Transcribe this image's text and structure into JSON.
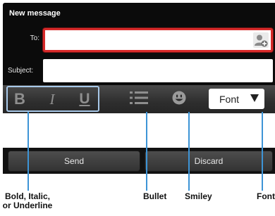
{
  "window": {
    "title": "New message"
  },
  "compose": {
    "to_label": "To:",
    "to_value": "",
    "subject_label": "Subject:",
    "subject_value": "",
    "body_value": ""
  },
  "toolbar": {
    "bold_glyph": "B",
    "italic_glyph": "I",
    "underline_glyph": "U",
    "font_label": "Font"
  },
  "actions": {
    "send_label": "Send",
    "discard_label": "Discard"
  },
  "callouts": {
    "bold_line1": "Bold, Italic,",
    "bold_line2": "or Underline",
    "bullet": "Bullet",
    "smiley": "Smiley",
    "font": "Font"
  },
  "colors": {
    "focus_border": "#d72a2a",
    "group_highlight": "#a8c8e8",
    "callout_line": "#3d94d6",
    "background": "#0b0b0b"
  },
  "icons": [
    "add-contact-icon",
    "bullet-list-icon",
    "smiley-icon",
    "dropdown-arrow-icon"
  ]
}
